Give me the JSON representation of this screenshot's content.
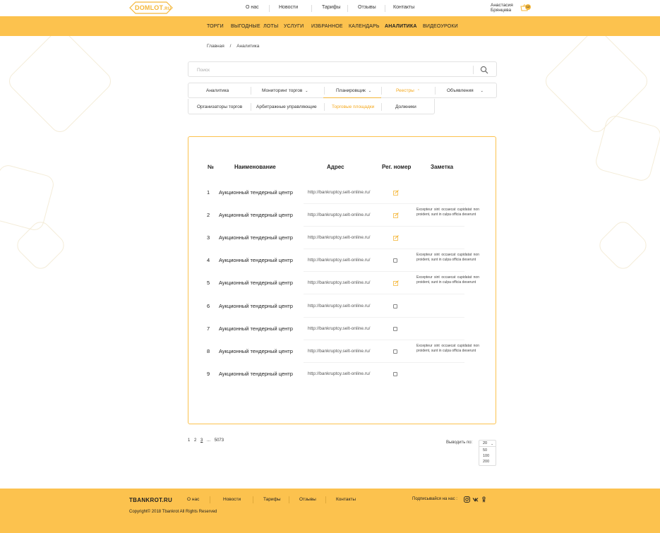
{
  "header": {
    "logo_text": "DOMLOT",
    "logo_suffix": ".RU",
    "top_nav": [
      "О нас",
      "Новости",
      "Тарифы",
      "Отзывы",
      "Контакты"
    ],
    "user_first": "Анастасия",
    "user_last": "Брянцева",
    "cart_count": "12",
    "cart_icon": "basket-icon"
  },
  "menu": {
    "items": [
      "ТОРГИ",
      "ВЫГОДНЫЕ  ЛОТЫ",
      "УСЛУГИ",
      "ИЗБРАННОЕ",
      "КАЛЕНДАРЬ",
      "АНАЛИТИКА",
      "ВИДЕОУРОКИ"
    ],
    "active": "АНАЛИТИКА"
  },
  "breadcrumb": {
    "home": "Главная",
    "sep": "/",
    "current": "Аналитика"
  },
  "search": {
    "placeholder": "Поиск",
    "icon": "search-icon"
  },
  "tabs": {
    "items": [
      "Аналитика",
      "Мониторинг торгов",
      "Планировщик",
      "Реестры",
      "Объявления"
    ],
    "active": "Реестры"
  },
  "subtabs": {
    "items": [
      "Организаторы торгов",
      "Арбитражные управляющие",
      "Торговые площадки",
      "Должники"
    ],
    "active": "Торговые площадки"
  },
  "table": {
    "headers": {
      "num": "№",
      "name": "Наименование",
      "address": "Адрес",
      "reg": "Рег. номер",
      "note": "Заметка"
    },
    "rows": [
      {
        "num": "1",
        "name": "Аукционный тендерный центр",
        "address": "http://bankruptcy.selt-online.ru/",
        "mark": "edit",
        "note": ""
      },
      {
        "num": "2",
        "name": "Аукционный тендерный центр",
        "address": "http://bankruptcy.selt-online.ru/",
        "mark": "edit",
        "note": "Excepteur sint occaecat cupidatat non proident, sunt in culpa officia deserunt"
      },
      {
        "num": "3",
        "name": "Аукционный тендерный центр",
        "address": "http://bankruptcy.selt-online.ru/",
        "mark": "edit",
        "note": ""
      },
      {
        "num": "4",
        "name": "Аукционный тендерный центр",
        "address": "http://bankruptcy.selt-online.ru/",
        "mark": "box",
        "note": "Excepteur sint occaecat cupidatat non proident, sunt in culpa officia deserunt"
      },
      {
        "num": "5",
        "name": "Аукционный тендерный центр",
        "address": "http://bankruptcy.selt-online.ru/",
        "mark": "edit",
        "note": "Excepteur sint occaecat cupidatat non proident, sunt in culpa officia deserunt"
      },
      {
        "num": "6",
        "name": "Аукционный тендерный центр",
        "address": "http://bankruptcy.selt-online.ru/",
        "mark": "box",
        "note": ""
      },
      {
        "num": "7",
        "name": "Аукционный тендерный центр",
        "address": "http://bankruptcy.selt-online.ru/",
        "mark": "box",
        "note": ""
      },
      {
        "num": "8",
        "name": "Аукционный тендерный центр",
        "address": "http://bankruptcy.selt-online.ru/",
        "mark": "box",
        "note": "Excepteur sint occaecat cupidatat non proident, sunt in culpa officia deserunt"
      },
      {
        "num": "9",
        "name": "Аукционный тендерный центр",
        "address": "http://bankruptcy.selt-online.ru/",
        "mark": "box",
        "note": ""
      }
    ]
  },
  "pagination": {
    "pages": [
      "1",
      "2",
      "3",
      "...",
      "5073"
    ],
    "current": "3",
    "per_page_label": "Выводить по:",
    "per_page_selected": "20",
    "per_page_options": [
      "50",
      "100",
      "200"
    ]
  },
  "footer": {
    "brand": "TBANKROT.RU",
    "links": [
      "О нас",
      "Новости",
      "Тарифы",
      "Отзывы",
      "Контакты"
    ],
    "copyright": "Copyright© 2018 Tbankrot All Rights Reserved",
    "subscribe": "Подписывайся на нас :",
    "social_icons": [
      "instagram-icon",
      "vk-icon",
      "odnoklassniki-icon"
    ]
  },
  "colors": {
    "accent": "#fcc24e",
    "accent_text": "#f4a81c"
  }
}
